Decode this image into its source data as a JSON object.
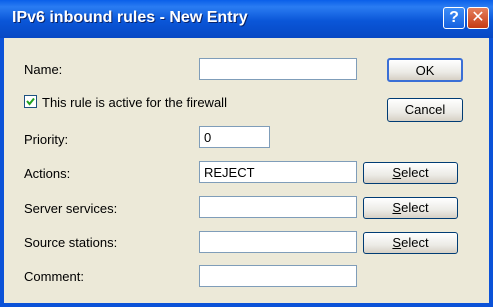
{
  "window": {
    "title": "IPv6 inbound rules - New Entry",
    "help_glyph": "?",
    "close_glyph": "✕"
  },
  "form": {
    "name_label": "Name:",
    "name_value": "",
    "active_label": "This rule is active for the firewall",
    "active_checked": true,
    "priority_label": "Priority:",
    "priority_value": "0",
    "actions_label": "Actions:",
    "actions_value": "REJECT",
    "server_services_label": "Server services:",
    "server_services_value": "",
    "source_stations_label": "Source stations:",
    "source_stations_value": "",
    "comment_label": "Comment:",
    "comment_value": ""
  },
  "buttons": {
    "ok": "OK",
    "cancel": "Cancel",
    "select_rest": "elect",
    "select_mnemonic": "S"
  }
}
